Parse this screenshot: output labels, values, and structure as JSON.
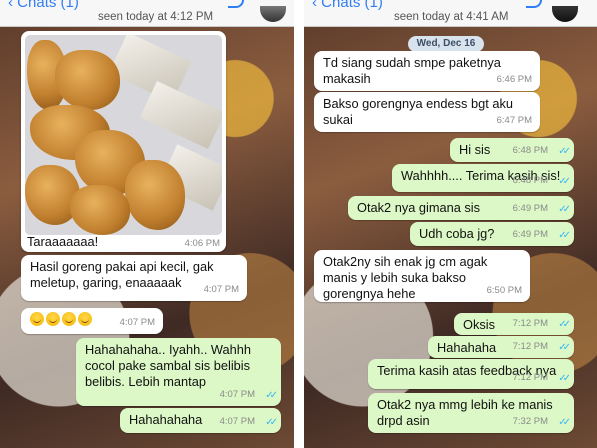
{
  "left": {
    "header": {
      "back_label": "Chats (1)",
      "seen": "seen today at 4:12 PM"
    },
    "photo": {
      "caption": "Taraaaaaaa!",
      "time": "4:06 PM"
    },
    "messages": [
      {
        "text": "Hasil goreng pakai api kecil, gak meletup, garing, enaaaaak",
        "time": "4:07 PM"
      },
      {
        "text": "",
        "time": "4:07 PM",
        "emoji_count": 4
      },
      {
        "text": "Hahahahaha.. Iyahh.. Wahhh cocol pake sambal sis belibis belibis. Lebih mantap",
        "time": "4:07 PM"
      },
      {
        "text": "Hahahahaha",
        "time": "4:07 PM"
      }
    ]
  },
  "right": {
    "header": {
      "back_label": "Chats (1)",
      "seen": "seen today at 4:41 AM"
    },
    "date_pill": "Wed, Dec 16",
    "messages": [
      {
        "text": "Td siang sudah smpe paketnya makasih",
        "time": "6:46 PM"
      },
      {
        "text": "Bakso gorengnya endess bgt aku sukai",
        "time": "6:47 PM"
      },
      {
        "text": "Hi sis",
        "time": "6:48 PM"
      },
      {
        "text": "Wahhhh.... Terima kasih sis!",
        "time": "6:48 PM"
      },
      {
        "text": "Otak2 nya gimana sis",
        "time": "6:49 PM"
      },
      {
        "text": "Udh coba jg?",
        "time": "6:49 PM"
      },
      {
        "text": "Otak2ny sih enak jg cm agak manis y lebih suka bakso gorengnya hehe",
        "time": "6:50 PM"
      },
      {
        "text": "Oksis",
        "time": "7:12 PM"
      },
      {
        "text": "Hahahaha",
        "time": "7:12 PM"
      },
      {
        "text": "Terima kasih atas feedback nya",
        "time": "7:12 PM"
      },
      {
        "text": "Otak2 nya mmg lebih ke manis drpd asin",
        "time": "7:32 PM"
      }
    ]
  },
  "read_tick_glyph": "✓✓"
}
